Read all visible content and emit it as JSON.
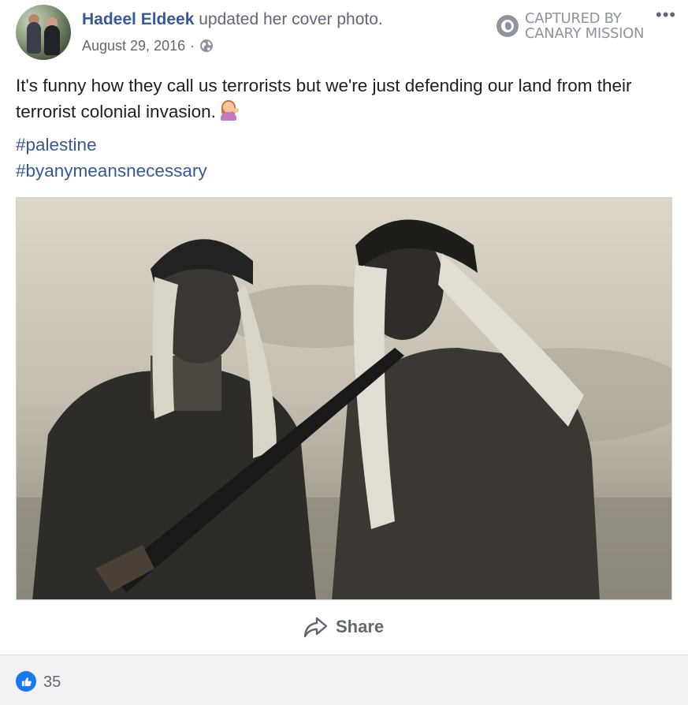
{
  "post": {
    "author": "Hadeel Eldeek",
    "action": "updated her cover photo.",
    "date": "August 29, 2016",
    "separator": "·",
    "privacy_icon": "globe-icon",
    "watermark": {
      "line1": "CAPTURED BY",
      "line2": "CANARY MISSION",
      "icon": "canary-logo-icon"
    },
    "more_icon": "•••",
    "text": "It's funny how they call us terrorists but we're just defending our land from their terrorist colonial invasion.",
    "emoji": "woman-tipping-hand-emoji",
    "hashtags": [
      "#palestine",
      "#byanymeansnecessary"
    ],
    "photo_icon": "cover-photo"
  },
  "actions": {
    "share_label": "Share",
    "share_icon": "share-arrow-icon"
  },
  "reactions": {
    "like_icon": "like-icon",
    "count": "35"
  },
  "colors": {
    "link": "#385898",
    "meta": "#606770",
    "footer_bg": "#f2f3f5",
    "like_blue": "#1877f2"
  }
}
